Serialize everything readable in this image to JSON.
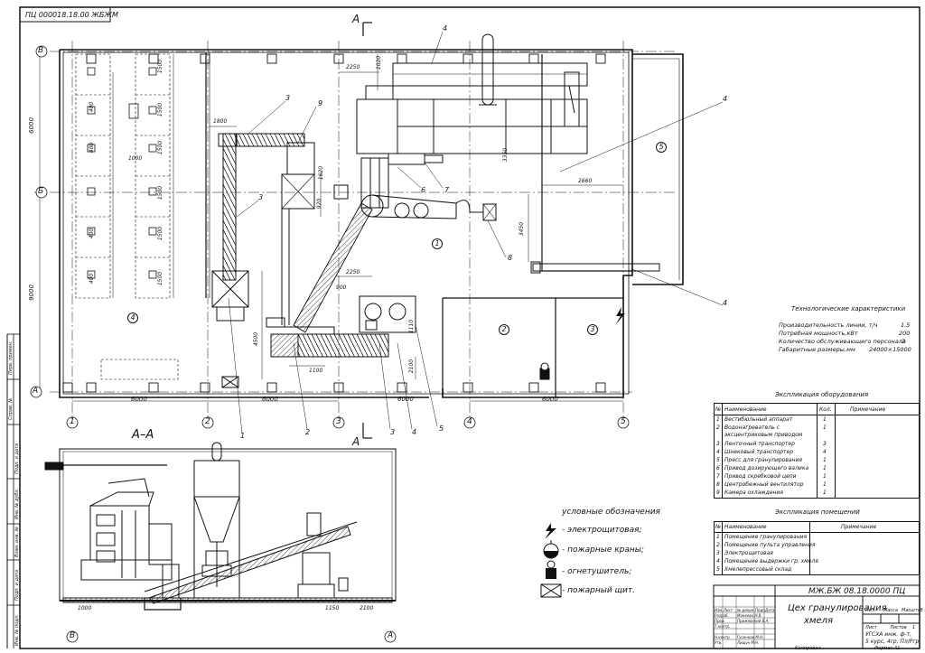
{
  "stamp": "ПЦ 000018.18.00 ЖБЖМ",
  "section_marker": "А",
  "section_title": "А–А",
  "axes_rows": [
    "В",
    "Б",
    "А"
  ],
  "axes_cols": [
    "1",
    "2",
    "3",
    "4",
    "5"
  ],
  "dims": {
    "bay": "6000",
    "row_upper": "6000",
    "row_lower": "9000",
    "d1500": "1500",
    "d400": "400",
    "d1000": "1000",
    "d1800": "1800",
    "d2250": "2250",
    "d1020": "1020",
    "d1620": "1620",
    "d920": "920",
    "d3350": "3350",
    "d2660": "2660",
    "d3450": "3450",
    "d900": "900",
    "d4500": "4500",
    "d1100": "1100",
    "d2100": "2100",
    "d1150": "1150",
    "d1110": "1110"
  },
  "callouts": [
    "1",
    "2",
    "3",
    "4",
    "5",
    "6",
    "7",
    "8",
    "9"
  ],
  "rooms": [
    "1",
    "2",
    "3",
    "4",
    "5"
  ],
  "tech": {
    "title": "Технологические характеристики",
    "rows": [
      {
        "label": "Производительность линии, т/ч",
        "value": "1.5"
      },
      {
        "label": "Потребная мощность,кВт",
        "value": "200"
      },
      {
        "label": "Количество обслуживающего персонала",
        "value": "2"
      },
      {
        "label": "Габаритные размеры,мм",
        "value": "24000×15000"
      }
    ]
  },
  "equipment": {
    "title": "Экспликация оборудования",
    "headers": [
      "№",
      "Наименование",
      "Кол.",
      "Примечание"
    ],
    "rows": [
      {
        "n": "1",
        "name": "Вестибюльный аппарат",
        "qty": "1"
      },
      {
        "n": "2",
        "name": "Водонагреватель с эксцентриковым приводом",
        "qty": "1"
      },
      {
        "n": "3",
        "name": "Ленточный транспортер",
        "qty": "3"
      },
      {
        "n": "4",
        "name": "Шнековый транспортер",
        "qty": "4"
      },
      {
        "n": "5",
        "name": "Пресс для гранулирования",
        "qty": "1"
      },
      {
        "n": "6",
        "name": "Привод дозирующего валика",
        "qty": "1"
      },
      {
        "n": "7",
        "name": "Привод скребковой цепи",
        "qty": "1"
      },
      {
        "n": "8",
        "name": "Центробежный вентилятор",
        "qty": "1"
      },
      {
        "n": "9",
        "name": "Камера охлаждения",
        "qty": "1"
      }
    ]
  },
  "rooms_table": {
    "title": "Экспликация помещений",
    "headers": [
      "№",
      "Наименование",
      "Примечание"
    ],
    "rows": [
      {
        "n": "1",
        "name": "Помещение гранулирования"
      },
      {
        "n": "2",
        "name": "Помещение пульта управления"
      },
      {
        "n": "3",
        "name": "Электрощитовая"
      },
      {
        "n": "4",
        "name": "Помещение выдержки гр. хмеля"
      },
      {
        "n": "5",
        "name": "Хмелепрессовый склад"
      }
    ]
  },
  "legend": {
    "title": "условные обозначения",
    "items": [
      {
        "icon": "lightning-icon",
        "label": "- электрощитовая;"
      },
      {
        "icon": "fire-hydrant-icon",
        "label": "- пожарные краны;"
      },
      {
        "icon": "extinguisher-icon",
        "label": "- огнетушитель;"
      },
      {
        "icon": "fire-board-icon",
        "label": "- пожарный щит."
      }
    ]
  },
  "title_block": {
    "code": "МЖ.БЖ 08.18.0000 ПЦ",
    "name_line1": "Цех гранулирования",
    "name_line2": "хмеля",
    "lit": "Лит.",
    "mass": "Масса",
    "scale": "Масштаб",
    "sheet": "Лист",
    "sheets": "Листов",
    "sheets_count": "1",
    "org1": "УГСХА инж. ф-т,",
    "org2": "5 курс, 4гр, Пл/Ргр",
    "format": "Формат А1",
    "copied": "Копировал",
    "roles": [
      "Изм.",
      "Лист",
      "№ докум.",
      "Подп.",
      "Дата",
      "Разраб.",
      "Пров.",
      "Т.контр.",
      "Н.контр.",
      "Утв."
    ],
    "names": [
      "Мокеева Н.В.",
      "Прижевский В.А.",
      "Гусенков М.Н.",
      "Лищук М.Н."
    ]
  },
  "side_labels": [
    "Перв. примен.",
    "Справ. №",
    "Подп. и дата",
    "Инв. № дубл.",
    "Взам. инв. №",
    "Подп. и дата",
    "Инв. № подл."
  ]
}
